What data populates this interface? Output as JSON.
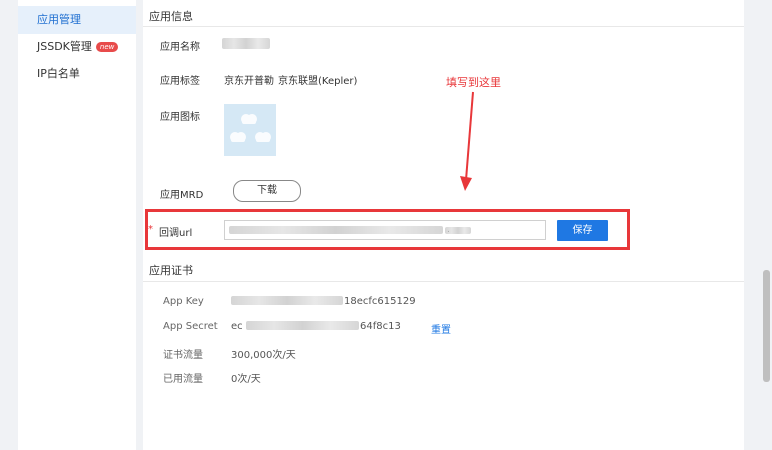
{
  "sidebar": {
    "items": [
      {
        "label": "应用管理",
        "active": true
      },
      {
        "label": "JSSDK管理",
        "badge": "new"
      },
      {
        "label": "IP白名单"
      }
    ]
  },
  "app_info": {
    "section_title": "应用信息",
    "name_label": "应用名称",
    "tags_label": "应用标签",
    "tags": [
      "京东开普勒",
      "京东联盟(Kepler)"
    ],
    "icon_label": "应用图标",
    "mrd_label": "应用MRD",
    "download_label": "下载",
    "callback_label": "回调url",
    "callback_required": "*",
    "callback_visible_suffix": ".",
    "save_label": "保存",
    "annotation": "填写到这里"
  },
  "cert": {
    "section_title": "应用证书",
    "app_key_label": "App Key",
    "app_key_visible_suffix": "18ecfc615129",
    "app_secret_label": "App Secret",
    "app_secret_visible_prefix": "ec",
    "app_secret_visible_suffix": "64f8c13",
    "reset_label": "重置",
    "quota_label": "证书流量",
    "quota_value": "300,000次/天",
    "used_label": "已用流量",
    "used_value": "0次/天"
  },
  "colors": {
    "accent": "#1f78e3",
    "highlight": "#e8373a",
    "active_bg": "#e6f0fb"
  }
}
